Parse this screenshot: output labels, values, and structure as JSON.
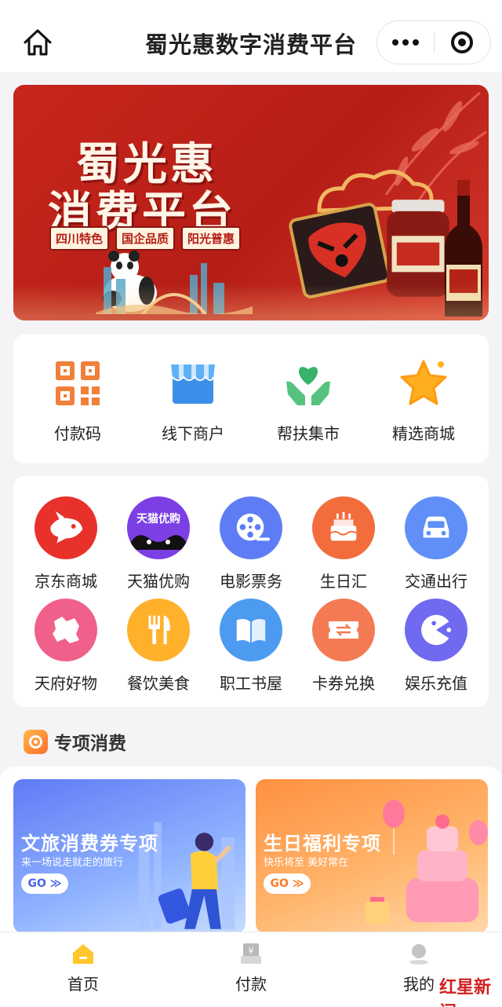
{
  "header": {
    "title": "蜀光惠数字消费平台"
  },
  "banner": {
    "headline_line1": "蜀光惠",
    "headline_line2": "消费平台",
    "tags": [
      "四川特色",
      "国企品质",
      "阳光普惠"
    ]
  },
  "quick_services": [
    {
      "label": "付款码",
      "icon": "qr-code-icon"
    },
    {
      "label": "线下商户",
      "icon": "storefront-icon"
    },
    {
      "label": "帮扶集市",
      "icon": "heart-hands-icon"
    },
    {
      "label": "精选商城",
      "icon": "star-icon"
    }
  ],
  "services": [
    {
      "label": "京东商城",
      "icon": "jd-dog-icon",
      "color": "#e8312a"
    },
    {
      "label": "天猫优购",
      "icon": "tmall-icon",
      "badge": "天猫优购",
      "color": "#7b3fe4"
    },
    {
      "label": "电影票务",
      "icon": "film-reel-icon",
      "color": "#5e7df5"
    },
    {
      "label": "生日汇",
      "icon": "birthday-cake-icon",
      "color": "#f26c3c"
    },
    {
      "label": "交通出行",
      "icon": "car-icon",
      "color": "#5f8ff7"
    },
    {
      "label": "天府好物",
      "icon": "sichuan-map-icon",
      "color": "#f0608a"
    },
    {
      "label": "餐饮美食",
      "icon": "fork-knife-icon",
      "color": "#ffb12c"
    },
    {
      "label": "职工书屋",
      "icon": "book-icon",
      "color": "#4c9bf0"
    },
    {
      "label": "卡券兑换",
      "icon": "ticket-exchange-icon",
      "color": "#f47a53"
    },
    {
      "label": "娱乐充值",
      "icon": "pacman-icon",
      "color": "#6f6af0"
    }
  ],
  "special_section": {
    "title": "专项消费",
    "cards": [
      {
        "title": "文旅消费券专项",
        "subtitle": "来一场说走就走的旅行",
        "cta": "GO ≫"
      },
      {
        "title": "生日福利专项",
        "subtitle": "快乐将至 美好常在",
        "cta": "GO ≫"
      }
    ]
  },
  "tabbar": [
    {
      "label": "首页",
      "icon": "home-tab-icon",
      "active": true
    },
    {
      "label": "付款",
      "icon": "payment-tab-icon",
      "active": false
    },
    {
      "label": "我的",
      "icon": "profile-tab-icon",
      "active": false
    }
  ],
  "watermark": "红星新闻"
}
